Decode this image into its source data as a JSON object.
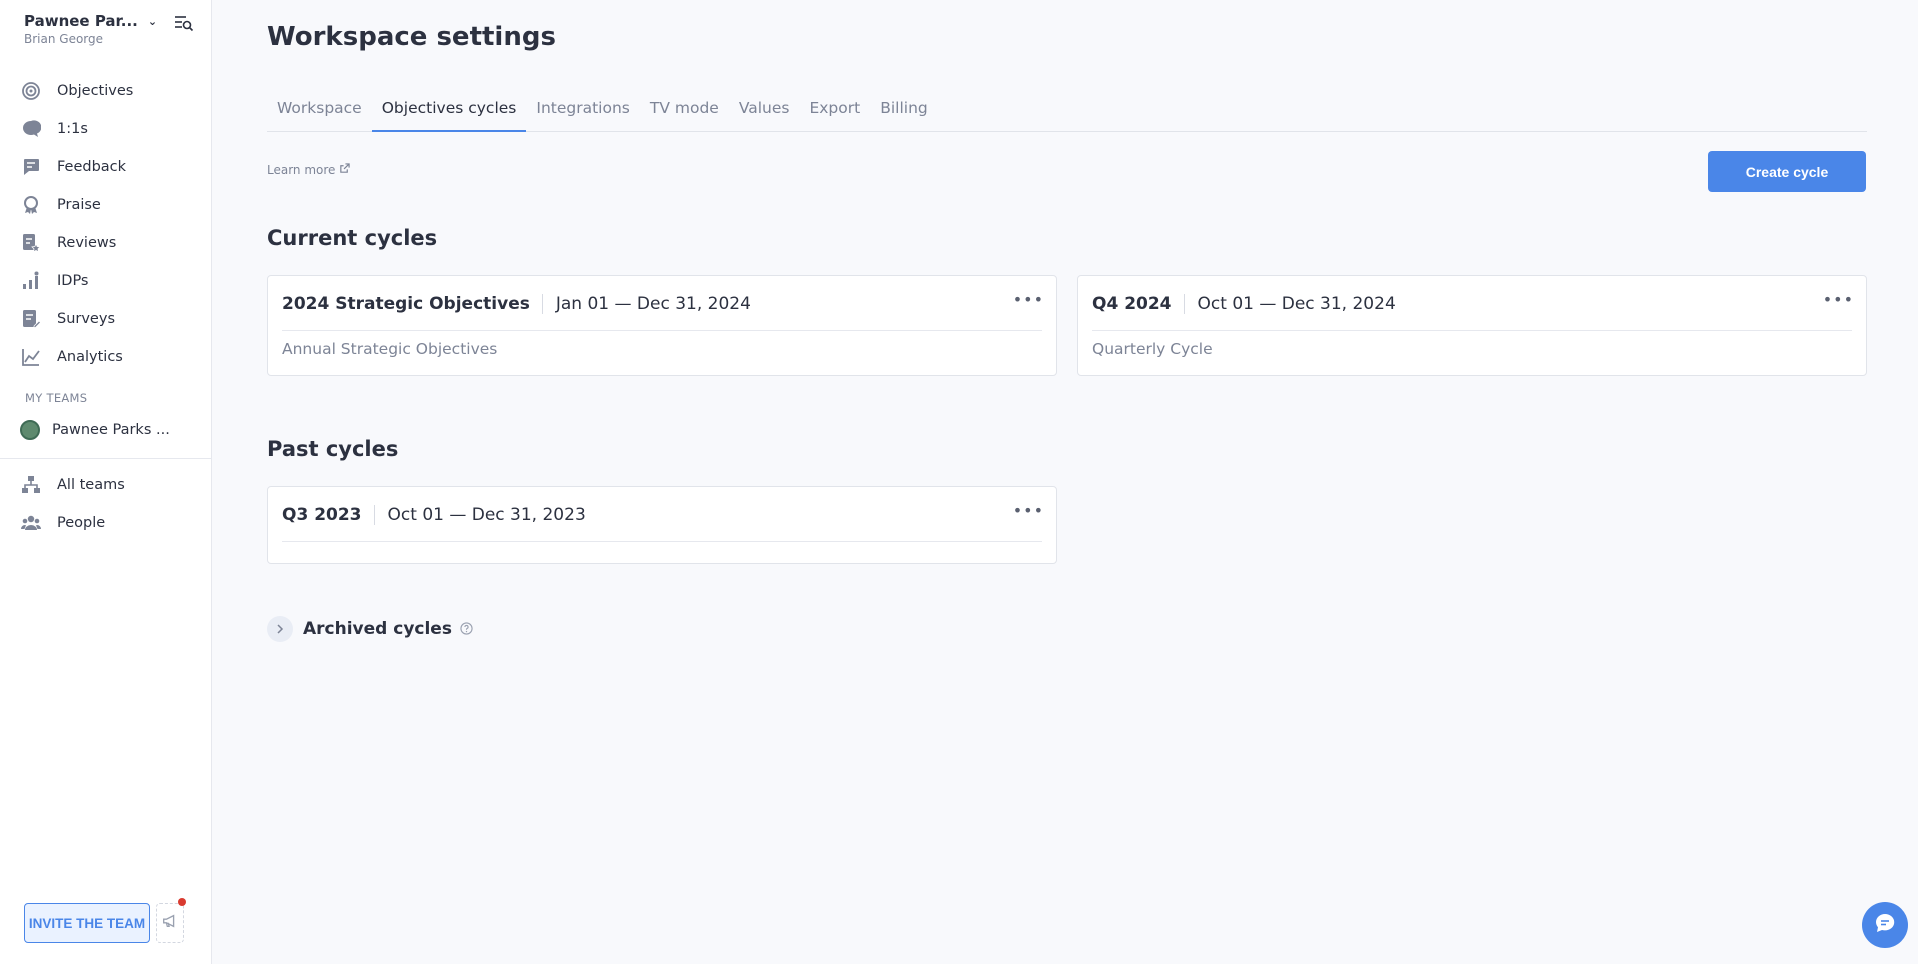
{
  "workspace": {
    "name": "Pawnee Par...",
    "user": "Brian George"
  },
  "sidebar": {
    "items": [
      {
        "label": "Objectives",
        "icon": "target-icon"
      },
      {
        "label": "1:1s",
        "icon": "chat-icon"
      },
      {
        "label": "Feedback",
        "icon": "feedback-icon"
      },
      {
        "label": "Praise",
        "icon": "award-icon"
      },
      {
        "label": "Reviews",
        "icon": "review-icon"
      },
      {
        "label": "IDPs",
        "icon": "growth-icon"
      },
      {
        "label": "Surveys",
        "icon": "survey-icon"
      },
      {
        "label": "Analytics",
        "icon": "chart-line-icon"
      }
    ],
    "my_teams_label": "MY TEAMS",
    "team": "Pawnee Parks ...",
    "items2": [
      {
        "label": "All teams",
        "icon": "org-chart-icon"
      },
      {
        "label": "People",
        "icon": "people-icon"
      }
    ],
    "invite_label": "INVITE THE TEAM"
  },
  "page": {
    "title": "Workspace settings",
    "tabs": [
      {
        "label": "Workspace"
      },
      {
        "label": "Objectives cycles",
        "active": true
      },
      {
        "label": "Integrations"
      },
      {
        "label": "TV mode"
      },
      {
        "label": "Values"
      },
      {
        "label": "Export"
      },
      {
        "label": "Billing"
      }
    ],
    "learn_more": "Learn more",
    "create_cycle": "Create cycle",
    "current_title": "Current cycles",
    "current": [
      {
        "name": "2024 Strategic Objectives",
        "dates": "Jan 01 — Dec 31, 2024",
        "desc": "Annual Strategic Objectives"
      },
      {
        "name": "Q4 2024",
        "dates": "Oct 01 — Dec 31, 2024",
        "desc": "Quarterly Cycle"
      }
    ],
    "past_title": "Past cycles",
    "past": [
      {
        "name": "Q3 2023",
        "dates": "Oct 01 — Dec 31, 2023",
        "desc": ""
      }
    ],
    "archived_label": "Archived cycles"
  },
  "colors": {
    "accent": "#4a86e8",
    "notification": "#d93b30"
  }
}
